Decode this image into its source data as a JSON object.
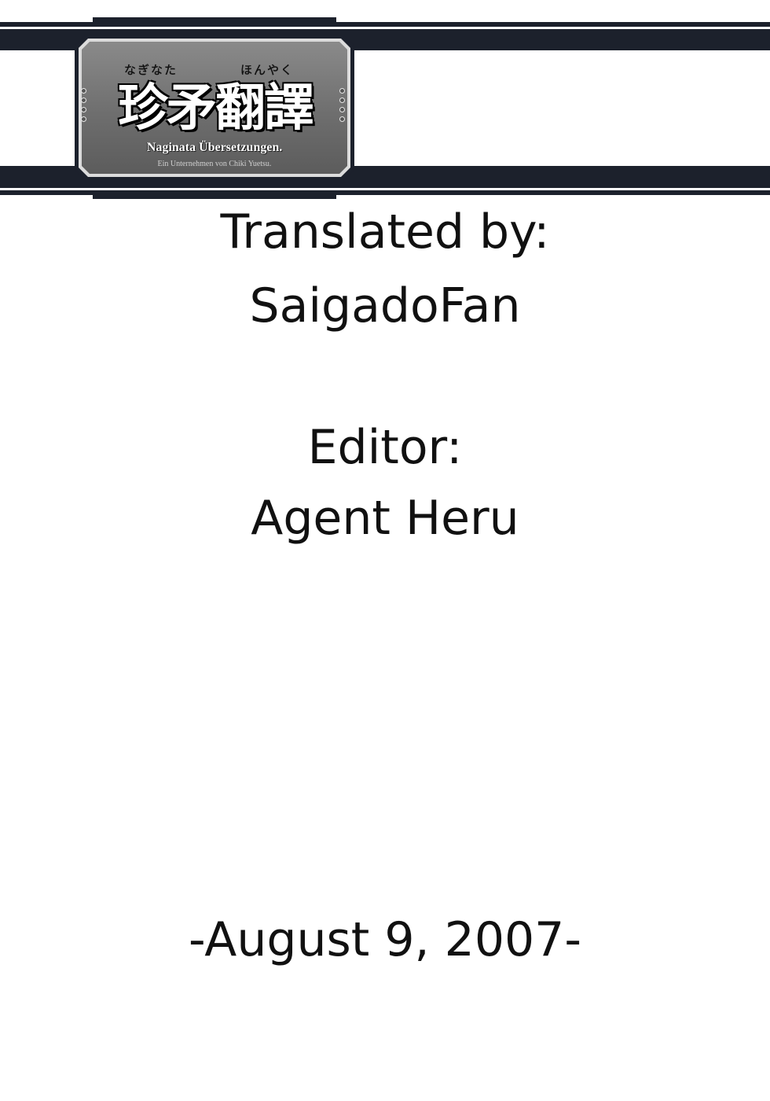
{
  "logo": {
    "ruby_left": "なぎなた",
    "ruby_right": "ほんやく",
    "kanji": "珍矛翻譯",
    "subtitle": "Naginata Übersetzungen.",
    "tagline": "Ein Unternehmen von Chiki Yuetsu."
  },
  "credits": {
    "translated_label": "Translated by:",
    "translator": "SaigadoFan",
    "editor_label": "Editor:",
    "editor": "Agent Heru",
    "date": "-August 9, 2007-"
  },
  "colors": {
    "band": "#1c212c",
    "plate": "#6e6e6e",
    "text": "#111111"
  }
}
